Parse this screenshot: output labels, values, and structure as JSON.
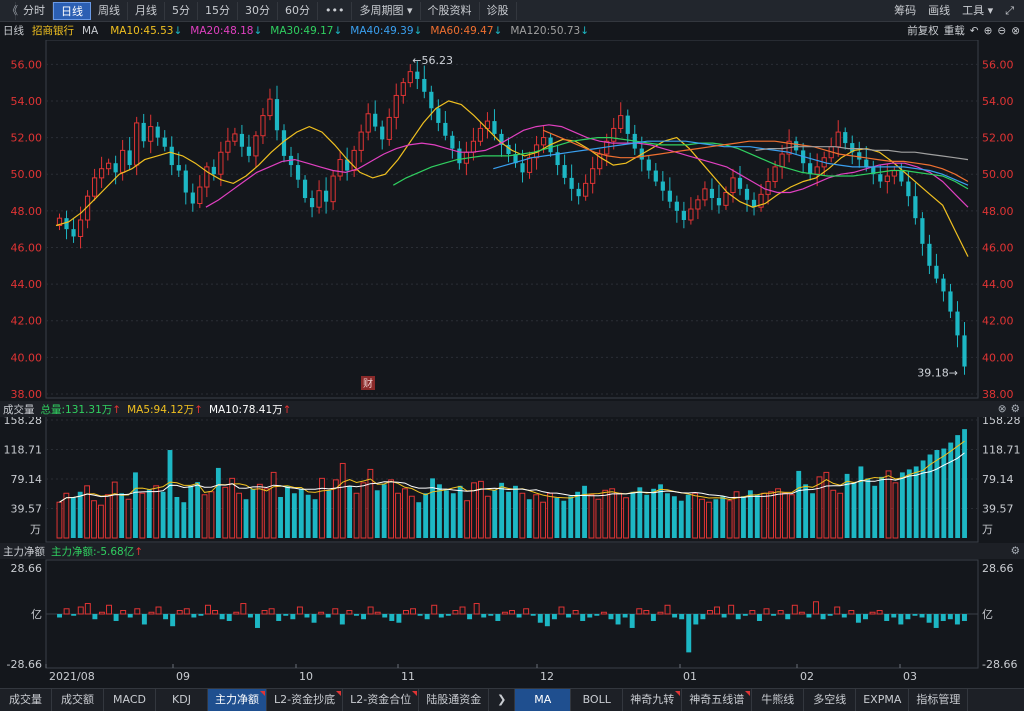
{
  "toolbar": {
    "left_icon": "《",
    "items": [
      "分时",
      "日线",
      "周线",
      "月线",
      "5分",
      "15分",
      "30分",
      "60分",
      "•••",
      "多周期图 ▾",
      "个股资料",
      "诊股"
    ],
    "active_index": 1,
    "right_items": [
      "筹码",
      "画线",
      "工具 ▾"
    ],
    "expand_icon": "⤢"
  },
  "info": {
    "period": "日线",
    "stock_name": "招商银行",
    "ma_label": "MA",
    "ma10": "MA10:45.53",
    "ma20": "MA20:48.18",
    "ma30": "MA30:49.17",
    "ma40": "MA40:49.39",
    "ma60": "MA60:49.47",
    "ma120": "MA120:50.73",
    "down_arrow": "↓",
    "fq": "前复权",
    "redraw": "重载"
  },
  "colors": {
    "up": "#e03434",
    "down": "#1db7c4",
    "ma5": "#ffffff",
    "ma10": "#f0c020",
    "ma20": "#e040c0",
    "ma30": "#30d060",
    "ma40": "#3aa0f0",
    "ma60": "#f07030",
    "ma120": "#a0a0a0"
  },
  "price_panel": {
    "y_ticks": [
      "56.00",
      "54.00",
      "52.00",
      "50.00",
      "48.00",
      "46.00",
      "44.00",
      "42.00",
      "40.00",
      "38.00"
    ],
    "high_label": "←56.23",
    "low_label": "39.18→",
    "fin_badge": "财"
  },
  "volume_panel": {
    "title": "成交量",
    "total": "总量:131.31万",
    "ma5": "MA5:94.12万",
    "ma10": "MA10:78.41万",
    "up_arrow": "↑",
    "y_ticks": [
      "158.28",
      "118.71",
      "79.14",
      "39.57"
    ],
    "unit": "万"
  },
  "flow_panel": {
    "title": "主力净额",
    "value": "主力净额:-5.68亿",
    "up_arrow": "↑",
    "y_top": "28.66",
    "y_mid": "亿",
    "y_bottom": "-28.66"
  },
  "x_axis": [
    "2021/08",
    "09",
    "10",
    "11",
    "12",
    "01",
    "02",
    "03"
  ],
  "tabs": {
    "left": [
      "成交量",
      "成交额",
      "MACD",
      "KDJ",
      "主力净额",
      "L2-资金抄底",
      "L2-资金合位",
      "陆股通资金"
    ],
    "left_active": 4,
    "arrow": "❯",
    "right": [
      "MA",
      "BOLL",
      "神奇九转",
      "神奇五线谱",
      "牛熊线",
      "多空线",
      "EXPMA",
      "指标管理"
    ],
    "right_active": 0
  },
  "chart_data": [
    {
      "type": "candlestick",
      "ylim": [
        38,
        57
      ],
      "y_ticks": [
        56,
        54,
        52,
        50,
        48,
        46,
        44,
        42,
        40,
        38
      ],
      "x_labels": [
        "2021/08",
        "09",
        "10",
        "11",
        "12",
        "01",
        "02",
        "03"
      ],
      "annotations": [
        {
          "text": "←56.23",
          "value": 56.23
        },
        {
          "text": "39.18→",
          "value": 39.18
        }
      ],
      "series": [
        {
          "name": "MA10",
          "legend": "MA10:45.53"
        },
        {
          "name": "MA20",
          "legend": "MA20:48.18"
        },
        {
          "name": "MA30",
          "legend": "MA30:49.17"
        },
        {
          "name": "MA40",
          "legend": "MA40:49.39"
        },
        {
          "name": "MA60",
          "legend": "MA60:49.47"
        },
        {
          "name": "MA120",
          "legend": "MA120:50.73"
        }
      ],
      "close_path": [
        47.6,
        47.0,
        46.6,
        47.5,
        48.8,
        49.8,
        50.3,
        50.6,
        50.1,
        51.3,
        50.5,
        52.8,
        51.8,
        52.6,
        52.0,
        51.5,
        50.5,
        50.2,
        49.0,
        48.4,
        49.3,
        50.4,
        50.0,
        51.2,
        51.8,
        52.2,
        51.5,
        51.0,
        52.1,
        53.2,
        54.1,
        52.4,
        51.0,
        50.5,
        49.7,
        48.7,
        48.2,
        49.1,
        48.5,
        49.9,
        50.8,
        50.2,
        51.3,
        52.3,
        53.3,
        52.6,
        51.9,
        53.1,
        54.3,
        55.0,
        55.6,
        55.2,
        54.5,
        53.6,
        52.8,
        52.1,
        51.4,
        50.6,
        51.2,
        51.8,
        52.5,
        52.9,
        52.2,
        51.6,
        51.1,
        50.6,
        50.1,
        50.9,
        51.6,
        52.0,
        51.2,
        50.5,
        49.8,
        49.2,
        48.8,
        49.5,
        50.3,
        51.1,
        51.8,
        52.5,
        53.2,
        52.2,
        51.4,
        50.8,
        50.2,
        49.6,
        49.1,
        48.5,
        48.0,
        47.5,
        48.1,
        48.6,
        49.2,
        48.7,
        48.3,
        49.0,
        49.8,
        49.2,
        48.6,
        48.2,
        48.9,
        49.6,
        50.4,
        51.1,
        51.8,
        51.3,
        50.6,
        50.0,
        50.4,
        50.9,
        51.5,
        52.3,
        51.7,
        51.2,
        50.8,
        50.4,
        50.0,
        49.6,
        49.9,
        50.2,
        49.6,
        48.8,
        47.6,
        46.2,
        45.0,
        44.3,
        43.6,
        42.5,
        41.2,
        39.5
      ],
      "ma_paths": {
        "MA10": [
          47.2,
          47.4,
          47.9,
          48.6,
          49.3,
          50.0,
          50.3,
          50.8,
          51.0,
          51.2,
          51.0,
          50.6,
          50.1,
          49.7,
          49.5,
          49.9,
          50.5,
          51.2,
          51.8,
          52.3,
          52.6,
          52.3,
          51.6,
          50.8,
          50.1,
          49.8,
          50.0,
          50.8,
          51.8,
          52.8,
          53.6,
          54.0,
          53.8,
          53.2,
          52.5,
          51.8,
          51.3,
          51.0,
          51.2,
          51.6,
          51.9,
          51.8,
          51.4,
          50.9,
          50.5,
          50.6,
          51.0,
          51.4,
          51.8,
          52.0,
          51.4,
          50.6,
          49.8,
          49.0,
          48.5,
          48.2,
          48.4,
          48.9,
          49.3,
          49.6,
          49.8,
          50.3,
          50.9,
          51.3,
          51.4,
          51.2,
          50.7,
          50.1,
          49.5,
          48.9,
          48.3,
          46.9,
          45.5
        ],
        "MA20": [
          48.2,
          48.6,
          49.1,
          49.6,
          50.1,
          50.4,
          50.7,
          50.8,
          50.6,
          50.4,
          50.2,
          50.1,
          50.3,
          50.7,
          51.1,
          51.4,
          51.6,
          51.7,
          51.6,
          51.4,
          51.2,
          51.2,
          51.3,
          51.6,
          52.0,
          52.4,
          52.6,
          52.7,
          52.6,
          52.3,
          52.0,
          51.8,
          51.7,
          51.7,
          51.7,
          51.6,
          51.4,
          51.2,
          51.0,
          50.8,
          50.6,
          50.4,
          50.0,
          49.6,
          49.2,
          49.0,
          49.0,
          49.2,
          49.5,
          49.8,
          50.0,
          50.1,
          50.3,
          50.5,
          50.6,
          50.6,
          50.4,
          50.1,
          49.6,
          48.9,
          48.2
        ],
        "MA30": [
          49.4,
          49.8,
          50.1,
          50.4,
          50.6,
          50.8,
          50.9,
          51.0,
          51.0,
          51.0,
          51.1,
          51.2,
          51.4,
          51.6,
          51.8,
          51.9,
          52.0,
          52.0,
          51.9,
          51.8,
          51.7,
          51.6,
          51.6,
          51.6,
          51.7,
          51.7,
          51.6,
          51.4,
          51.1,
          50.8,
          50.5,
          50.3,
          50.1,
          50.0,
          49.9,
          49.9,
          49.9,
          50.0,
          50.1,
          50.2,
          50.2,
          50.1,
          50.0,
          49.9,
          49.6,
          49.2
        ],
        "MA40": [
          50.3,
          50.5,
          50.7,
          50.9,
          51.0,
          51.1,
          51.2,
          51.3,
          51.4,
          51.5,
          51.6,
          51.7,
          51.8,
          51.8,
          51.8,
          51.8,
          51.7,
          51.6,
          51.5,
          51.5,
          51.5,
          51.4,
          51.3,
          51.2,
          51.0,
          50.8,
          50.6,
          50.5,
          50.4,
          50.4,
          50.4,
          50.4,
          50.4,
          50.3,
          50.2,
          50.0,
          49.7,
          49.4
        ],
        "MA60": [
          52.4,
          52.1,
          51.8,
          51.5,
          51.2,
          51.0,
          50.9,
          50.9,
          51.0,
          51.1,
          51.2,
          51.3,
          51.4,
          51.5,
          51.6,
          51.7,
          51.8,
          51.8,
          51.8,
          51.7,
          51.6,
          51.5,
          51.3,
          51.1,
          51.0,
          50.9,
          50.8,
          50.7,
          50.7,
          50.6,
          50.5,
          50.3,
          50.0,
          49.6
        ],
        "MA120": [
          51.3,
          51.4,
          51.4,
          51.5,
          51.5,
          51.5,
          51.5,
          51.4,
          51.4,
          51.3,
          51.3,
          51.2,
          51.2,
          51.1,
          51.0,
          50.9,
          50.8
        ]
      }
    },
    {
      "type": "bar",
      "title": "成交量",
      "ylim": [
        0,
        158.28
      ],
      "y_ticks": [
        158.28,
        118.71,
        79.14,
        39.57
      ],
      "unit": "万",
      "series": [
        {
          "name": "MA5",
          "legend": "MA5:94.12万"
        },
        {
          "name": "MA10",
          "legend": "MA10:78.41万"
        }
      ],
      "totals": "总量:131.31万",
      "values_path": [
        48,
        60,
        55,
        62,
        70,
        50,
        44,
        58,
        75,
        60,
        52,
        88,
        60,
        65,
        70,
        62,
        118,
        55,
        48,
        70,
        75,
        58,
        62,
        94,
        68,
        80,
        60,
        52,
        66,
        72,
        66,
        88,
        55,
        70,
        60,
        66,
        58,
        52,
        80,
        64,
        78,
        100,
        70,
        60,
        74,
        92,
        64,
        72,
        78,
        60,
        66,
        56,
        48,
        60,
        80,
        72,
        64,
        60,
        70,
        50,
        74,
        76,
        56,
        64,
        74,
        62,
        70,
        60,
        52,
        58,
        48,
        60,
        54,
        50,
        56,
        62,
        70,
        58,
        52,
        64,
        66,
        60,
        54,
        62,
        68,
        58,
        66,
        72,
        60,
        56,
        50,
        58,
        60,
        52,
        48,
        52,
        56,
        50,
        62,
        56,
        64,
        58,
        60,
        62,
        66,
        60,
        58,
        90,
        72,
        60,
        82,
        88,
        64,
        60,
        86,
        74,
        96,
        80,
        70,
        82,
        90,
        74,
        88,
        92,
        96,
        104,
        112,
        118,
        120,
        128,
        138,
        146
      ]
    },
    {
      "type": "bar",
      "title": "主力净额",
      "ylim": [
        -28.66,
        28.66
      ],
      "unit": "亿",
      "value_label": "主力净额:-5.68亿",
      "values_path": [
        -2,
        3,
        -1,
        4,
        6,
        -3,
        1,
        5,
        -4,
        2,
        -2,
        3,
        -6,
        1,
        4,
        -3,
        -7,
        2,
        3,
        -2,
        -1,
        5,
        2,
        -3,
        -4,
        1,
        6,
        -2,
        -8,
        2,
        3,
        -4,
        -1,
        -3,
        4,
        -2,
        -5,
        1,
        -2,
        3,
        -6,
        2,
        -1,
        -3,
        4,
        1,
        -2,
        -4,
        -5,
        2,
        3,
        -1,
        -3,
        5,
        -2,
        -1,
        2,
        4,
        -3,
        6,
        -2,
        -1,
        -4,
        1,
        2,
        -2,
        3,
        -1,
        -5,
        -7,
        -3,
        4,
        -2,
        2,
        -4,
        -2,
        -1,
        1,
        -3,
        -6,
        -2,
        -8,
        3,
        2,
        -4,
        1,
        5,
        -2,
        -3,
        -22,
        -6,
        -3,
        2,
        4,
        -2,
        5,
        -3,
        -1,
        2,
        -4,
        3,
        -1,
        2,
        -3,
        5,
        1,
        -2,
        7,
        -3,
        -1,
        4,
        -2,
        2,
        -5,
        -3,
        1,
        2,
        -4,
        -2,
        -6,
        -3,
        -1,
        -2,
        -5,
        -8,
        -4,
        -3,
        -6,
        -4
      ]
    }
  ]
}
